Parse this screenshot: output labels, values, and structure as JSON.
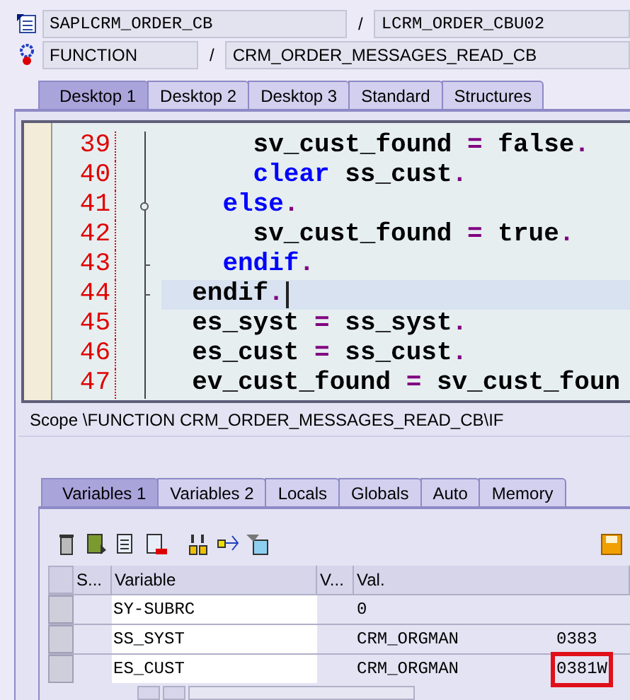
{
  "header": {
    "program": "SAPLCRM_ORDER_CB",
    "separator_1": "/",
    "include": "LCRM_ORDER_CBU02",
    "event_type": "FUNCTION",
    "separator_2": "/",
    "event_name": "CRM_ORDER_MESSAGES_READ_CB"
  },
  "desktop_tabs": [
    {
      "label": "Desktop 1",
      "selected": true
    },
    {
      "label": "Desktop 2",
      "selected": false
    },
    {
      "label": "Desktop 3",
      "selected": false
    },
    {
      "label": "Standard",
      "selected": false
    },
    {
      "label": "Structures",
      "selected": false
    }
  ],
  "code_lines": [
    {
      "number": "39",
      "current": false,
      "tokens": [
        {
          "text": "      sv_cust_found ",
          "kind": "plain"
        },
        {
          "text": "=",
          "kind": "operator"
        },
        {
          "text": " false",
          "kind": "plain"
        },
        {
          "text": ".",
          "kind": "operator"
        }
      ]
    },
    {
      "number": "40",
      "current": false,
      "tokens": [
        {
          "text": "      clear",
          "kind": "keyword"
        },
        {
          "text": " ss_cust",
          "kind": "plain"
        },
        {
          "text": ".",
          "kind": "operator"
        }
      ]
    },
    {
      "number": "41",
      "kind": "fold_branch",
      "current": false,
      "tokens": [
        {
          "text": "    else",
          "kind": "keyword"
        },
        {
          "text": ".",
          "kind": "operator"
        }
      ]
    },
    {
      "number": "42",
      "current": false,
      "tokens": [
        {
          "text": "      sv_cust_found ",
          "kind": "plain"
        },
        {
          "text": "=",
          "kind": "operator"
        },
        {
          "text": " true",
          "kind": "plain"
        },
        {
          "text": ".",
          "kind": "operator"
        }
      ]
    },
    {
      "number": "43",
      "kind": "fold_end",
      "current": false,
      "tokens": [
        {
          "text": "    endif",
          "kind": "keyword"
        },
        {
          "text": ".",
          "kind": "operator"
        }
      ]
    },
    {
      "number": "44",
      "kind": "fold_end",
      "current": true,
      "tokens": [
        {
          "text": "  endif",
          "kind": "plain"
        },
        {
          "text": ".",
          "kind": "operator"
        }
      ]
    },
    {
      "number": "45",
      "current": false,
      "tokens": [
        {
          "text": "  es_syst ",
          "kind": "plain"
        },
        {
          "text": "=",
          "kind": "operator"
        },
        {
          "text": " ss_syst",
          "kind": "plain"
        },
        {
          "text": ".",
          "kind": "operator"
        }
      ]
    },
    {
      "number": "46",
      "current": false,
      "tokens": [
        {
          "text": "  es_cust ",
          "kind": "plain"
        },
        {
          "text": "=",
          "kind": "operator"
        },
        {
          "text": " ss_cust",
          "kind": "plain"
        },
        {
          "text": ".",
          "kind": "operator"
        }
      ]
    },
    {
      "number": "47",
      "current": false,
      "tokens": [
        {
          "text": "  ev_cust_found ",
          "kind": "plain"
        },
        {
          "text": "=",
          "kind": "operator"
        },
        {
          "text": " sv_cust_foun",
          "kind": "plain"
        }
      ]
    }
  ],
  "scope": "Scope \\FUNCTION CRM_ORDER_MESSAGES_READ_CB\\IF",
  "variable_tabs": [
    {
      "label": "Variables 1",
      "selected": true
    },
    {
      "label": "Variables 2",
      "selected": false
    },
    {
      "label": "Locals",
      "selected": false
    },
    {
      "label": "Globals",
      "selected": false
    },
    {
      "label": "Auto",
      "selected": false
    },
    {
      "label": "Memory",
      "selected": false
    }
  ],
  "table": {
    "columns": [
      "S...",
      "Variable",
      "V...",
      "Val."
    ],
    "rows": [
      {
        "variable": "SY-SUBRC",
        "value": "0"
      },
      {
        "variable": "SS_SYST",
        "value": "CRM_ORGMAN",
        "value_tail": "0383"
      },
      {
        "variable": "ES_CUST",
        "value": "CRM_ORGMAN",
        "value_tail": "0381W",
        "highlighted": true
      }
    ]
  }
}
